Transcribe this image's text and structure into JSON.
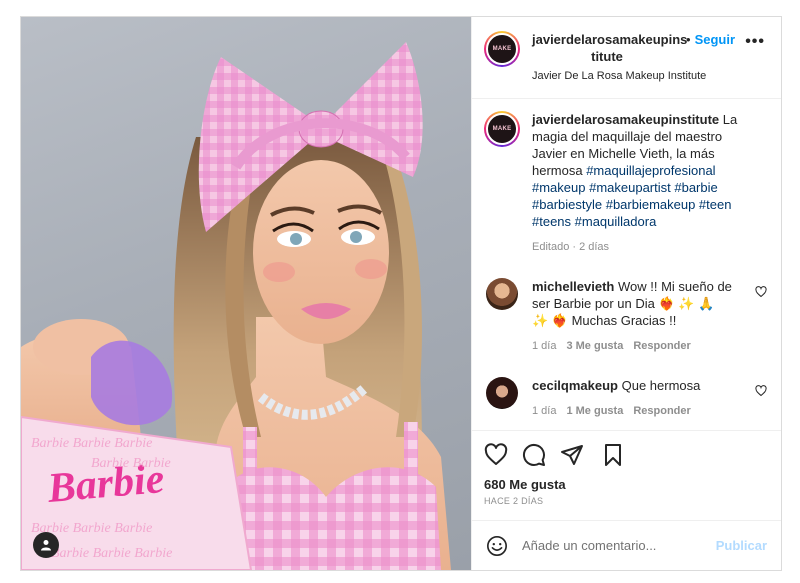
{
  "post": {
    "photo": {
      "alt_icon": "user-tag-icon",
      "brand_text": "Barbie"
    },
    "header": {
      "avatar_icon": "brand-avatar",
      "avatar_text": "MAKE",
      "username_line1": "javierdelarosamakeupins",
      "username_line2": "titute",
      "separator": "•",
      "follow_label": "Seguir",
      "more_icon": "more-options-icon",
      "more_label": "•••",
      "subtitle": "Javier De La Rosa Makeup Institute"
    },
    "caption": {
      "username": "javierdelarosamakeupinstitute",
      "text": " La magia del maquillaje del maestro Javier en Michelle Vieth, la más hermosa ",
      "hashtags": "#maquillajeprofesional #makeup #makeupartist #barbie #barbiestyle #barbiemakeup #teen #teens #maquilladora",
      "meta": "Editado · 2 días"
    },
    "comments": [
      {
        "username": "michellevieth",
        "text": " Wow !! Mi sueño de ser Barbie por un Dia ❤️‍🔥 ✨ 🙏 ✨ ❤️‍🔥 Muchas Gracias !!",
        "time": "1 día",
        "likes": "3 Me gusta",
        "reply": "Responder"
      },
      {
        "username": "cecilqmakeup",
        "text": " Que hermosa",
        "time": "1 día",
        "likes": "1 Me gusta",
        "reply": "Responder"
      }
    ],
    "actions": {
      "icons": [
        "heart-icon",
        "comment-icon",
        "share-icon",
        "bookmark-icon"
      ],
      "likes": "680 Me gusta",
      "date": "HACE 2 DÍAS"
    },
    "add_comment": {
      "placeholder": "Añade un comentario...",
      "publish_label": "Publicar"
    },
    "colors": {
      "accent": "#0095f6",
      "link": "#00376b",
      "muted": "#8e8e8e",
      "publish_disabled": "#b3dbff"
    }
  }
}
